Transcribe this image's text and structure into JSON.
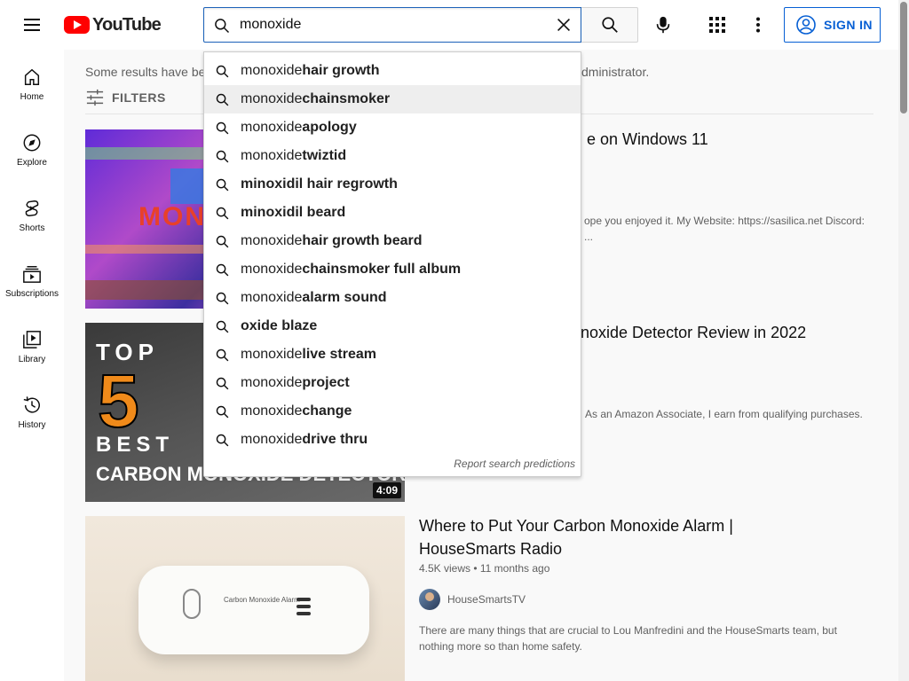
{
  "header": {
    "logo_text": "YouTube",
    "search_value": "monoxide",
    "sign_in_label": "SIGN IN"
  },
  "sidebar": {
    "items": [
      {
        "label": "Home",
        "icon": "home-icon"
      },
      {
        "label": "Explore",
        "icon": "compass-icon"
      },
      {
        "label": "Shorts",
        "icon": "shorts-icon"
      },
      {
        "label": "Subscriptions",
        "icon": "subscriptions-icon"
      },
      {
        "label": "Library",
        "icon": "library-icon"
      },
      {
        "label": "History",
        "icon": "history-icon"
      }
    ]
  },
  "results": {
    "notice_left": "Some results have be",
    "notice_right": "dministrator.",
    "filters_label": "FILTERS",
    "videos": [
      {
        "title_fragment": "e on Windows 11",
        "desc_fragment_1": "ope you enjoyed it. My Website: https://sasilica.net Discord:",
        "desc_fragment_2": "...",
        "thumb_text": "MON"
      },
      {
        "title_fragment": "noxide Detector Review in 2022",
        "desc_fragment_1": "As an Amazon Associate, I earn from qualifying purchases.",
        "duration": "4:09",
        "thumb_top": "TOP",
        "thumb_number": "5",
        "thumb_best": "BEST",
        "thumb_caption": "CARBON MONOXIDE DETECTOR"
      },
      {
        "title_line1": "Where to Put Your Carbon Monoxide Alarm |",
        "title_line2": "HouseSmarts Radio",
        "meta": "4.5K views • 11 months ago",
        "channel": "HouseSmartsTV",
        "desc_line1": "There are many things that are crucial to Lou Manfredini and the HouseSmarts team, but",
        "desc_line2": "nothing more so than home safety.",
        "thumb_label": "Carbon Monoxide Alarm"
      }
    ]
  },
  "suggestions": {
    "prefix": "monoxide",
    "items": [
      {
        "prefix": "monoxide",
        "rest": " hair growth"
      },
      {
        "prefix": "monoxide",
        "rest": " chainsmoker"
      },
      {
        "prefix": "monoxide",
        "rest": " apology"
      },
      {
        "prefix": "monoxide",
        "rest": " twiztid"
      },
      {
        "prefix": "",
        "rest": "minoxidil hair regrowth"
      },
      {
        "prefix": "",
        "rest": "minoxidil beard"
      },
      {
        "prefix": "monoxide",
        "rest": " hair growth beard"
      },
      {
        "prefix": "monoxide",
        "rest": " chainsmoker full album"
      },
      {
        "prefix": "monoxide",
        "rest": " alarm sound"
      },
      {
        "prefix": "",
        "rest": "oxide blaze"
      },
      {
        "prefix": "monoxide",
        "rest": " live stream"
      },
      {
        "prefix": "monoxide",
        "rest": " project"
      },
      {
        "prefix": "monoxide",
        "rest": " change"
      },
      {
        "prefix": "monoxide",
        "rest": " drive thru"
      }
    ],
    "report_label": "Report search predictions"
  },
  "colors": {
    "brand_red": "#ff0000",
    "link_blue": "#065fd4",
    "search_border": "#1c62b9"
  }
}
